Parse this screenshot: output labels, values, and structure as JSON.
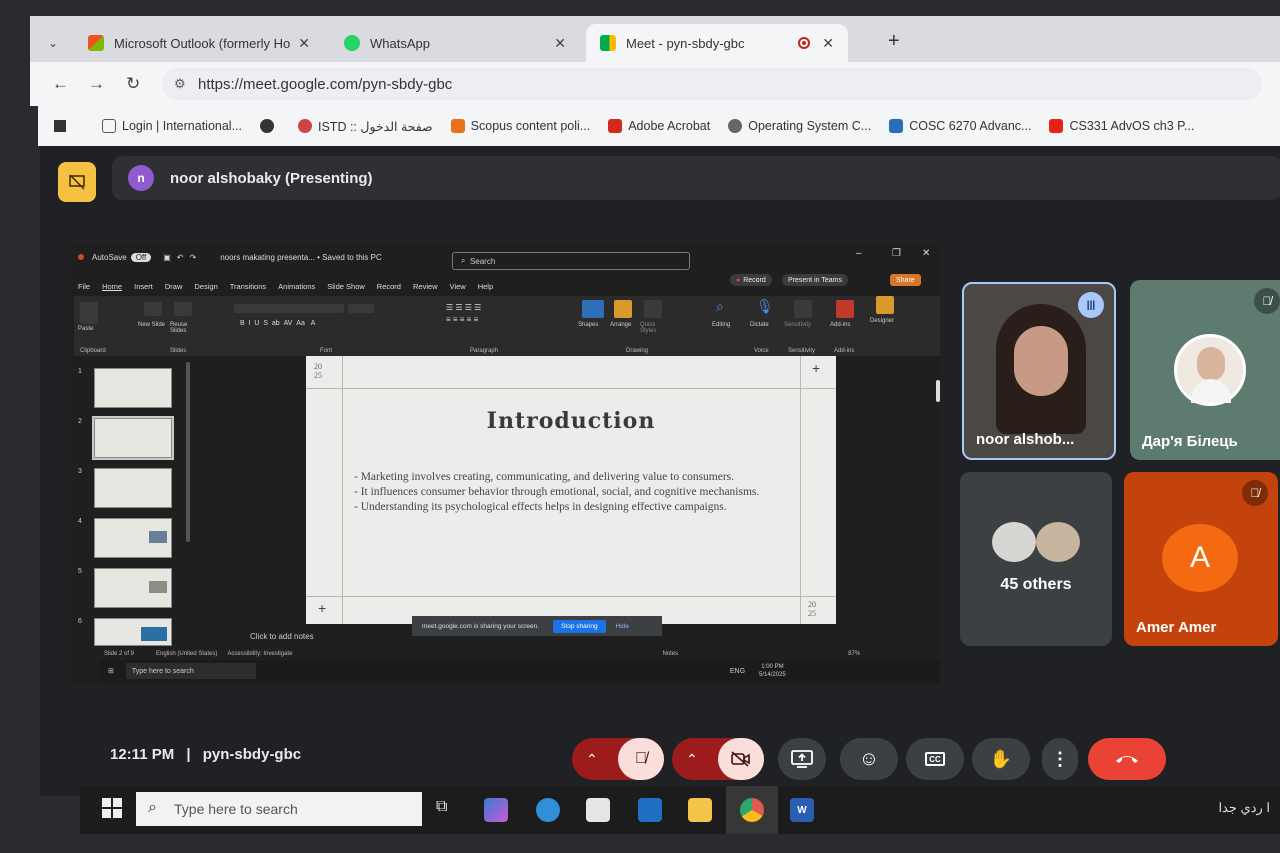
{
  "browser": {
    "tabs": [
      {
        "label": "Microsoft Outlook (formerly Ho",
        "favicon_color": "#f25022"
      },
      {
        "label": "WhatsApp",
        "favicon_color": "#25d366"
      },
      {
        "label": "Meet - pyn-sbdy-gbc",
        "favicon_color": "#00ac47",
        "active": true
      }
    ],
    "url": "https://meet.google.com/pyn-sbdy-gbc",
    "bookmarks": [
      {
        "label": "Login | International...",
        "color": "#555"
      },
      {
        "label": "",
        "color": "#333"
      },
      {
        "label": "ISTD :: صفحة الدخول",
        "color": "#b33"
      },
      {
        "label": "Scopus content poli...",
        "color": "#e9711c"
      },
      {
        "label": "Adobe Acrobat",
        "color": "#d4291d"
      },
      {
        "label": "Operating System C...",
        "color": "#555"
      },
      {
        "label": "COSC 6270 Advanc...",
        "color": "#2a6ebb"
      },
      {
        "label": "CS331 AdvOS ch3 P...",
        "color": "#e62117"
      }
    ]
  },
  "meet": {
    "presenter_initial": "n",
    "presenting_label": "noor alshobaky (Presenting)",
    "meeting_time": "12:11 PM",
    "meeting_separator": "|",
    "meeting_code": "pyn-sbdy-gbc",
    "participants": [
      {
        "name": "noor alshob...",
        "speaking": true
      },
      {
        "name": "Дар'я Білець",
        "muted": true
      },
      {
        "name": "45 others"
      },
      {
        "name": "Amer Amer",
        "initial": "A",
        "muted": true
      }
    ]
  },
  "powerpoint": {
    "autosave": "AutoSave",
    "autosave_state": "Off",
    "doc_title": "noors makating presenta... • Saved to this PC",
    "search_placeholder": "Search",
    "menu": [
      "File",
      "Home",
      "Insert",
      "Draw",
      "Design",
      "Transitions",
      "Animations",
      "Slide Show",
      "Record",
      "Review",
      "View",
      "Help"
    ],
    "record_label": "Record",
    "present_teams_label": "Present in Teams",
    "share_label": "Share",
    "ribbon_groups": [
      "Clipboard",
      "Slides",
      "Font",
      "Paragraph",
      "Drawing",
      "Voice",
      "Sensitivity",
      "Add-ins"
    ],
    "ribbon_buttons": [
      "Paste",
      "New Slide",
      "Reuse Slides",
      "Shapes",
      "Arrange",
      "Quick Styles",
      "Editing",
      "Dictate",
      "Sensitivity",
      "Add-ins",
      "Designer"
    ],
    "thumbnail_numbers": [
      "1",
      "2",
      "3",
      "4",
      "5",
      "6"
    ],
    "notes_placeholder": "Click to add notes",
    "status_slide": "Slide 2 of 9",
    "status_lang": "English (United States)",
    "status_access": "Accessibility: Investigate",
    "status_notes": "Notes",
    "zoom": "87%"
  },
  "slide": {
    "title": "Introduction",
    "year_top": "20\n25",
    "year_bottom": "20\n25",
    "bullets": [
      "- Marketing involves creating, communicating, and delivering value to consumers.",
      "- It influences consumer behavior through emotional, social, and cognitive mechanisms.",
      "- Understanding its psychological effects helps in designing effective campaigns."
    ]
  },
  "share_banner": {
    "text": "meet.google.com is sharing your screen.",
    "stop_label": "Stop sharing",
    "hide_label": "Hide"
  },
  "inner_taskbar": {
    "search_placeholder": "Type here to search",
    "lang": "ENG",
    "time": "1:00 PM",
    "date": "5/14/2025"
  },
  "taskbar": {
    "search_placeholder": "Type here to search",
    "right_text": "ا ردي جدا"
  }
}
